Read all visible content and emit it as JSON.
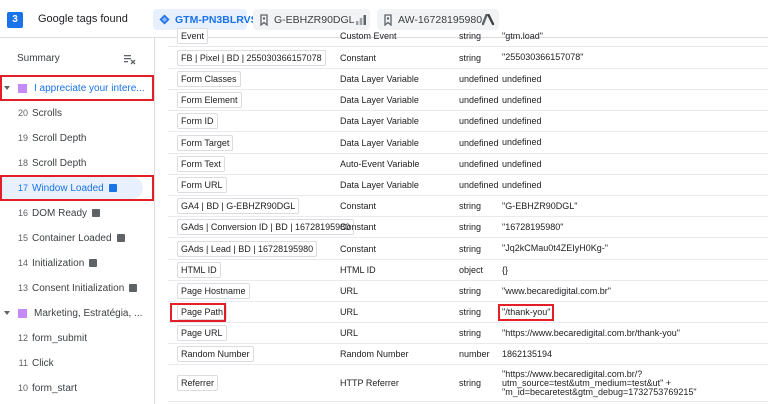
{
  "header": {
    "tag_count": "3",
    "found_label": "Google tags found",
    "containers": [
      {
        "id": "GTM-PN3BLRVS"
      },
      {
        "id": "G-EBHZR90DGL"
      },
      {
        "id": "AW-16728195980"
      }
    ]
  },
  "sidebar": {
    "summary_label": "Summary",
    "group1_label": "I appreciate your intere...",
    "items_group1": [
      {
        "num": "20",
        "label": "Scrolls"
      },
      {
        "num": "19",
        "label": "Scroll Depth"
      },
      {
        "num": "18",
        "label": "Scroll Depth"
      },
      {
        "num": "17",
        "label": "Window Loaded"
      },
      {
        "num": "16",
        "label": "DOM Ready"
      },
      {
        "num": "15",
        "label": "Container Loaded"
      },
      {
        "num": "14",
        "label": "Initialization"
      },
      {
        "num": "13",
        "label": "Consent Initialization"
      }
    ],
    "group2_label": "Marketing, Estratégia, ...",
    "items_group2": [
      {
        "num": "12",
        "label": "form_submit"
      },
      {
        "num": "11",
        "label": "Click"
      },
      {
        "num": "10",
        "label": "form_start"
      }
    ]
  },
  "variables": {
    "rows": [
      {
        "name": "Event",
        "type": "Custom Event",
        "dtype": "string",
        "value": "\"gtm.load\""
      },
      {
        "name": "FB | Pixel | BD | 255030366157078",
        "type": "Constant",
        "dtype": "string",
        "value": "\"255030366157078\""
      },
      {
        "name": "Form Classes",
        "type": "Data Layer Variable",
        "dtype": "undefined",
        "value": "undefined"
      },
      {
        "name": "Form Element",
        "type": "Data Layer Variable",
        "dtype": "undefined",
        "value": "undefined"
      },
      {
        "name": "Form ID",
        "type": "Data Layer Variable",
        "dtype": "undefined",
        "value": "undefined"
      },
      {
        "name": "Form Target",
        "type": "Data Layer Variable",
        "dtype": "undefined",
        "value": "undefined"
      },
      {
        "name": "Form Text",
        "type": "Auto-Event Variable",
        "dtype": "undefined",
        "value": "undefined"
      },
      {
        "name": "Form URL",
        "type": "Data Layer Variable",
        "dtype": "undefined",
        "value": "undefined"
      },
      {
        "name": "GA4 | BD | G-EBHZR90DGL",
        "type": "Constant",
        "dtype": "string",
        "value": "\"G-EBHZR90DGL\""
      },
      {
        "name": "GAds | Conversion ID | BD | 16728195980",
        "type": "Constant",
        "dtype": "string",
        "value": "\"16728195980\""
      },
      {
        "name": "GAds | Lead | BD | 16728195980",
        "type": "Constant",
        "dtype": "string",
        "value": "\"Jq2kCMau0t4ZEIyH0Kg-\""
      },
      {
        "name": "HTML ID",
        "type": "HTML ID",
        "dtype": "object",
        "value": "{}"
      },
      {
        "name": "Page Hostname",
        "type": "URL",
        "dtype": "string",
        "value": "\"www.becaredigital.com.br\""
      },
      {
        "name": "Page Path",
        "type": "URL",
        "dtype": "string",
        "value": "\"/thank-you\""
      },
      {
        "name": "Page URL",
        "type": "URL",
        "dtype": "string",
        "value": "\"https://www.becaredigital.com.br/thank-you\""
      },
      {
        "name": "Random Number",
        "type": "Random Number",
        "dtype": "number",
        "value": "1862135194"
      },
      {
        "name": "Referrer",
        "type": "HTTP Referrer",
        "dtype": "string",
        "value": "\"https://www.becaredigital.com.br/?\nutm_source=test&utm_medium=test&ut\" +\n\"m_id=becaretest&gtm_debug=1732753769215\""
      }
    ]
  },
  "colors": {
    "accent": "#1a73e8",
    "highlight_border": "#e41e26",
    "swatch": "#c58af9"
  }
}
